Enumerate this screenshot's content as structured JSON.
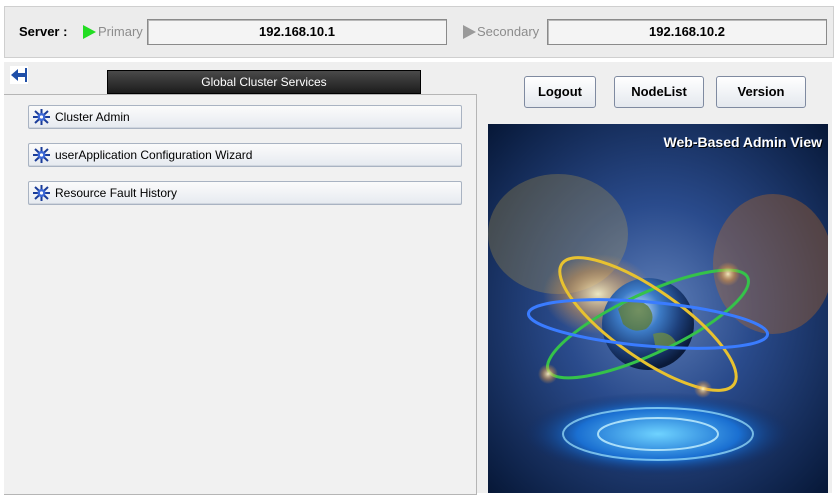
{
  "server": {
    "label": "Server :",
    "primary": {
      "label": "Primary",
      "ip": "192.168.10.1",
      "status_color": "#22dd22"
    },
    "secondary": {
      "label": "Secondary",
      "ip": "192.168.10.2",
      "status_color": "#9a9a9a"
    }
  },
  "left": {
    "header": "Global Cluster Services",
    "menu": [
      {
        "label": "Cluster Admin",
        "icon": "cluster-gear-icon"
      },
      {
        "label": "userApplication Configuration Wizard",
        "icon": "cluster-gear-icon"
      },
      {
        "label": "Resource Fault History",
        "icon": "cluster-gear-icon"
      }
    ]
  },
  "right": {
    "buttons": {
      "logout": "Logout",
      "nodelist": "NodeList",
      "version": "Version"
    },
    "splash_title": "Web-Based Admin View"
  }
}
